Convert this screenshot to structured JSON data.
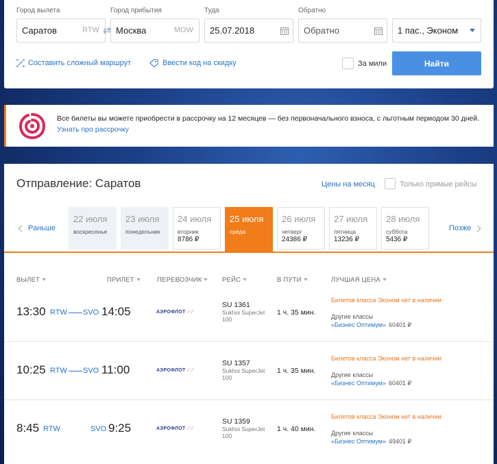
{
  "search": {
    "from_label": "Город вылета",
    "from_value": "Саратов",
    "from_code": "RTW",
    "to_label": "Город прибытия",
    "to_value": "Москва",
    "to_code": "MOW",
    "depart_label": "Туда",
    "depart_value": "25.07.2018",
    "return_label": "Обратно",
    "return_placeholder": "Обратно",
    "passengers_value": "1 пас., Эконом",
    "complex_route_link": "Составить сложный маршрут",
    "promo_code_link": "Ввести код на скидку",
    "miles_label": "За мили",
    "search_button": "Найти"
  },
  "promo": {
    "text": "Все билеты вы можете приобрести в рассрочку на 12 месяцев — без первоначального взноса, с льготным периодом 30 дней.",
    "link": "Узнать про рассрочку"
  },
  "results": {
    "title": "Отправление: Саратов",
    "prices_month_link": "Цены на месяц",
    "direct_only_label": "Только прямые рейсы",
    "earlier_link": "Раньше",
    "later_link": "Позже",
    "dates": [
      {
        "date": "22 июля",
        "weekday": "воскресенье",
        "price": ""
      },
      {
        "date": "23 июля",
        "weekday": "понедельник",
        "price": ""
      },
      {
        "date": "24 июля",
        "weekday": "вторник",
        "price": "8786 ₽"
      },
      {
        "date": "25 июля",
        "weekday": "среда",
        "price": ""
      },
      {
        "date": "26 июля",
        "weekday": "четверг",
        "price": "24386 ₽"
      },
      {
        "date": "27 июля",
        "weekday": "пятница",
        "price": "13236 ₽"
      },
      {
        "date": "28 июля",
        "weekday": "суббота",
        "price": "5436 ₽"
      }
    ],
    "columns": {
      "depart": "ВЫЛЕТ",
      "arrive": "ПРИЛЕТ",
      "carrier": "ПЕРЕВОЗЧИК",
      "flight": "РЕЙС",
      "duration": "В ПУТИ",
      "best_price": "ЛУЧШАЯ ЦЕНА"
    },
    "flights": [
      {
        "depart_time": "13:30",
        "depart_code": "RTW",
        "arrive_code": "SVO",
        "arrive_time": "14:05",
        "carrier": "АЭРОФЛОТ",
        "flight_no": "SU 1361",
        "aircraft": "Sukhoi SuperJet 100",
        "duration": "1 ч. 35 мин.",
        "economy_note": "Билетов класса Эконом нет в наличии",
        "other_classes": "Другие классы",
        "class_name": "«Бизнес Оптимум»",
        "price": "60401 ₽"
      },
      {
        "depart_time": "10:25",
        "depart_code": "RTW",
        "arrive_code": "SVO",
        "arrive_time": "11:00",
        "carrier": "АЭРОФЛОТ",
        "flight_no": "SU 1357",
        "aircraft": "Sukhoi SuperJet 100",
        "duration": "1 ч. 35 мин.",
        "economy_note": "Билетов класса Эконом нет в наличии",
        "other_classes": "Другие классы",
        "class_name": "«Бизнес Оптимум»",
        "price": "60401 ₽"
      },
      {
        "depart_time": "8:45",
        "depart_code": "RTW",
        "arrive_code": "SVO",
        "arrive_time": "9:25",
        "carrier": "АЭРОФЛОТ",
        "flight_no": "SU 1359",
        "aircraft": "Sukhoi SuperJet 100",
        "duration": "1 ч. 40 мин.",
        "economy_note": "Билетов класса Эконом нет в наличии",
        "other_classes": "Другие классы",
        "class_name": "«Бизнес Оптимум»",
        "price": "49401 ₽"
      }
    ]
  },
  "colors": {
    "accent_orange": "#f07c1a",
    "link_blue": "#2a73c5",
    "button_blue": "#4a90e2"
  }
}
